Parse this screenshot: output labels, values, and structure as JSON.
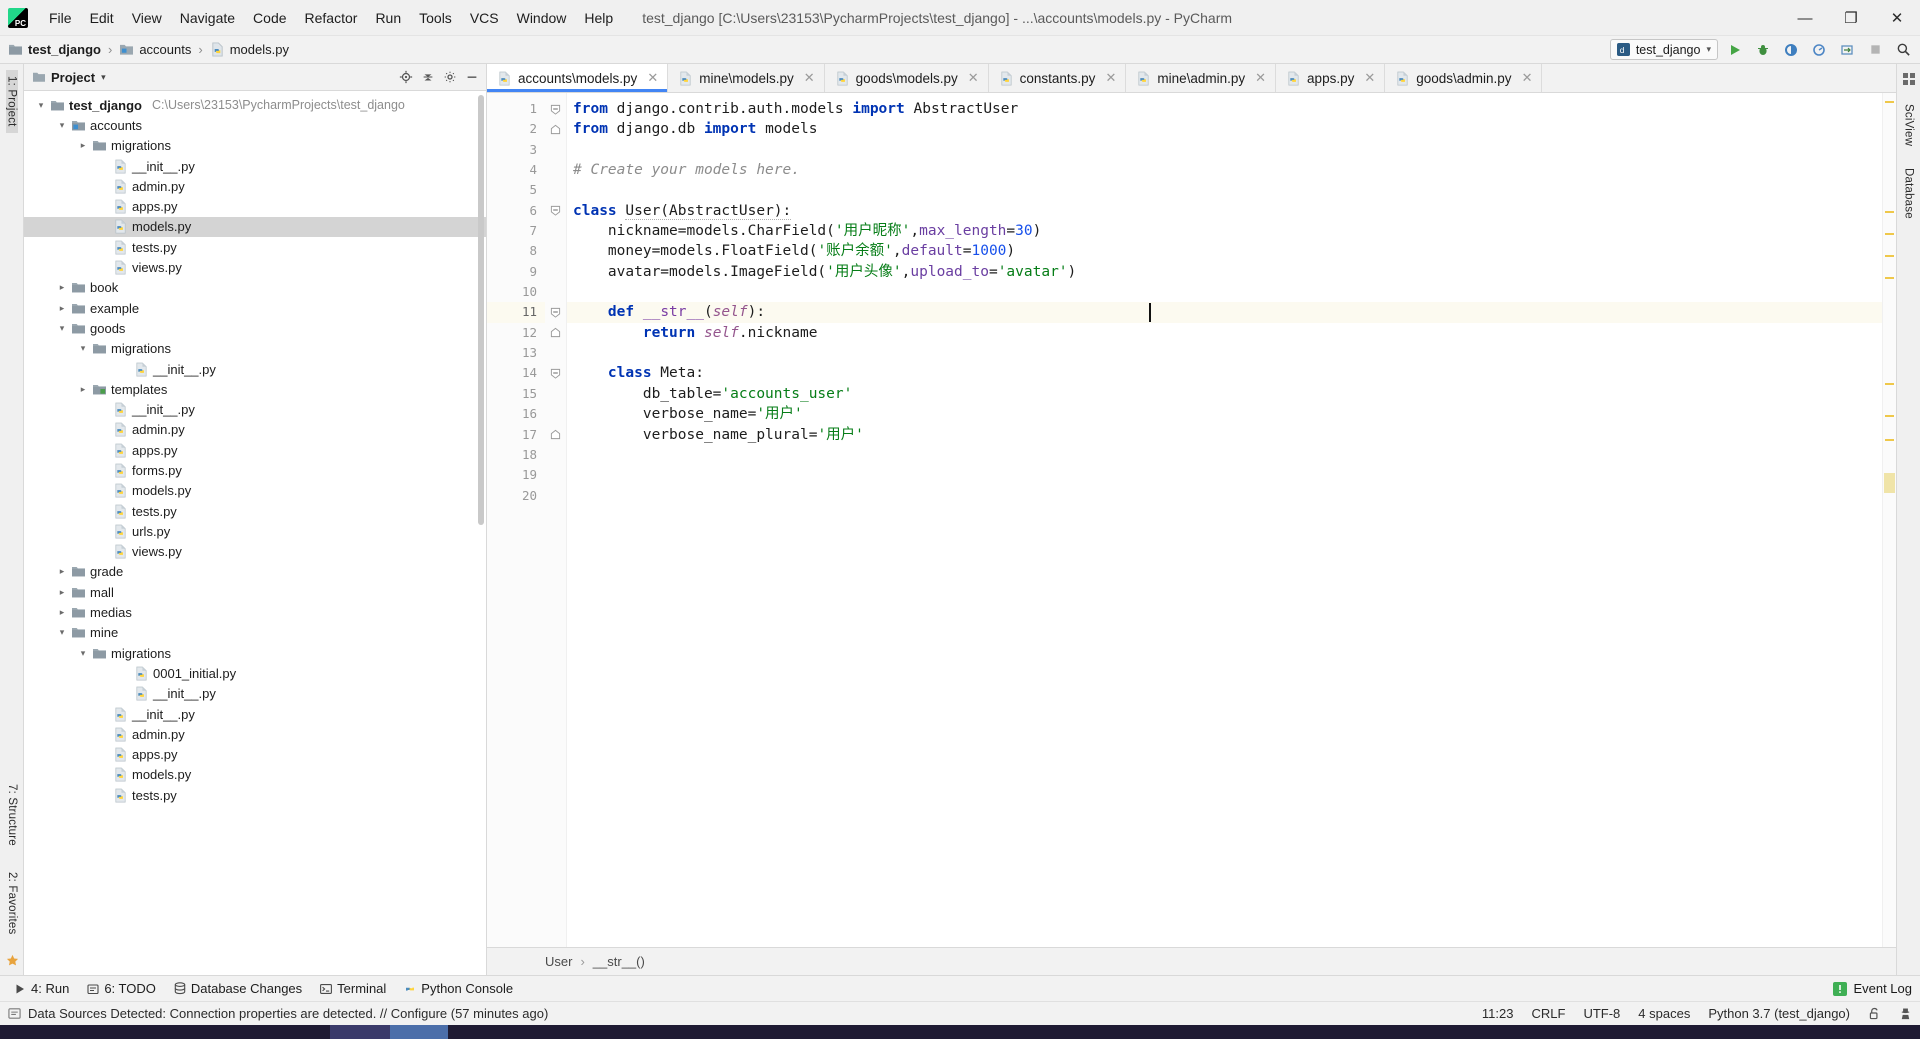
{
  "window": {
    "title": "test_django [C:\\Users\\23153\\PycharmProjects\\test_django] - ...\\accounts\\models.py - PyCharm",
    "minimize_label": "—",
    "maximize_label": "❐",
    "close_label": "✕",
    "logo_text": "PC"
  },
  "menubar": {
    "items": [
      {
        "label": "File"
      },
      {
        "label": "Edit"
      },
      {
        "label": "View"
      },
      {
        "label": "Navigate"
      },
      {
        "label": "Code"
      },
      {
        "label": "Refactor"
      },
      {
        "label": "Run"
      },
      {
        "label": "Tools"
      },
      {
        "label": "VCS"
      },
      {
        "label": "Window"
      },
      {
        "label": "Help"
      }
    ]
  },
  "breadcrumb": {
    "items": [
      {
        "label": "test_django",
        "icon": "folder-icon"
      },
      {
        "label": "accounts",
        "icon": "folder-icon"
      },
      {
        "label": "models.py",
        "icon": "python-file-icon"
      }
    ],
    "separator": "›"
  },
  "navbar_right": {
    "run_config": "test_django",
    "run_config_icon": "django-config-icon",
    "chevron": "▾",
    "buttons": [
      {
        "name": "run-button",
        "icon": "run-icon"
      },
      {
        "name": "debug-button",
        "icon": "debug-icon"
      },
      {
        "name": "run-coverage-button",
        "icon": "coverage-icon"
      },
      {
        "name": "profile-button",
        "icon": "profile-icon"
      },
      {
        "name": "attach-button",
        "icon": "attach-icon"
      },
      {
        "name": "stop-button",
        "icon": "stop-icon"
      },
      {
        "name": "search-everywhere-button",
        "icon": "search-icon"
      }
    ]
  },
  "left_rail": {
    "top_label": "1: Project",
    "bottom_labels": [
      "7: Structure",
      "2: Favorites"
    ]
  },
  "right_rail": {
    "labels": [
      "SciView",
      "Database"
    ]
  },
  "project_panel": {
    "title": "Project",
    "caret": "▾",
    "tools": [
      "locate-icon",
      "collapse-all-icon",
      "settings-icon",
      "hide-icon"
    ],
    "tree": [
      {
        "indent": 0,
        "arrow": "down",
        "icon": "folder-icon",
        "label": "test_django",
        "bold": true,
        "path": "C:\\Users\\23153\\PycharmProjects\\test_django"
      },
      {
        "indent": 1,
        "arrow": "down",
        "icon": "module-icon",
        "label": "accounts"
      },
      {
        "indent": 2,
        "arrow": "right",
        "icon": "folder-blue-icon",
        "label": "migrations"
      },
      {
        "indent": 3,
        "arrow": "none",
        "icon": "python-file-icon",
        "label": "__init__.py"
      },
      {
        "indent": 3,
        "arrow": "none",
        "icon": "python-file-icon",
        "label": "admin.py"
      },
      {
        "indent": 3,
        "arrow": "none",
        "icon": "python-file-icon",
        "label": "apps.py"
      },
      {
        "indent": 3,
        "arrow": "none",
        "icon": "python-file-icon",
        "label": "models.py",
        "selected": true
      },
      {
        "indent": 3,
        "arrow": "none",
        "icon": "python-file-icon",
        "label": "tests.py"
      },
      {
        "indent": 3,
        "arrow": "none",
        "icon": "python-file-icon",
        "label": "views.py"
      },
      {
        "indent": 1,
        "arrow": "right",
        "icon": "folder-blue-icon",
        "label": "book"
      },
      {
        "indent": 1,
        "arrow": "right",
        "icon": "folder-blue-icon",
        "label": "example"
      },
      {
        "indent": 1,
        "arrow": "down",
        "icon": "folder-blue-icon",
        "label": "goods"
      },
      {
        "indent": 2,
        "arrow": "down",
        "icon": "folder-blue-icon",
        "label": "migrations"
      },
      {
        "indent": 4,
        "arrow": "none",
        "icon": "python-file-icon",
        "label": "__init__.py"
      },
      {
        "indent": 2,
        "arrow": "right",
        "icon": "folder-green-icon",
        "label": "templates"
      },
      {
        "indent": 3,
        "arrow": "none",
        "icon": "python-file-icon",
        "label": "__init__.py"
      },
      {
        "indent": 3,
        "arrow": "none",
        "icon": "python-file-icon",
        "label": "admin.py"
      },
      {
        "indent": 3,
        "arrow": "none",
        "icon": "python-file-icon",
        "label": "apps.py"
      },
      {
        "indent": 3,
        "arrow": "none",
        "icon": "python-file-icon",
        "label": "forms.py"
      },
      {
        "indent": 3,
        "arrow": "none",
        "icon": "python-file-icon",
        "label": "models.py"
      },
      {
        "indent": 3,
        "arrow": "none",
        "icon": "python-file-icon",
        "label": "tests.py"
      },
      {
        "indent": 3,
        "arrow": "none",
        "icon": "python-file-icon",
        "label": "urls.py"
      },
      {
        "indent": 3,
        "arrow": "none",
        "icon": "python-file-icon",
        "label": "views.py"
      },
      {
        "indent": 1,
        "arrow": "right",
        "icon": "folder-blue-icon",
        "label": "grade"
      },
      {
        "indent": 1,
        "arrow": "right",
        "icon": "folder-blue-icon",
        "label": "mall"
      },
      {
        "indent": 1,
        "arrow": "right",
        "icon": "folder-blue-icon",
        "label": "medias"
      },
      {
        "indent": 1,
        "arrow": "down",
        "icon": "folder-blue-icon",
        "label": "mine"
      },
      {
        "indent": 2,
        "arrow": "down",
        "icon": "folder-blue-icon",
        "label": "migrations"
      },
      {
        "indent": 4,
        "arrow": "none",
        "icon": "python-file-icon",
        "label": "0001_initial.py"
      },
      {
        "indent": 4,
        "arrow": "none",
        "icon": "python-file-icon",
        "label": "__init__.py"
      },
      {
        "indent": 3,
        "arrow": "none",
        "icon": "python-file-icon",
        "label": "__init__.py"
      },
      {
        "indent": 3,
        "arrow": "none",
        "icon": "python-file-icon",
        "label": "admin.py"
      },
      {
        "indent": 3,
        "arrow": "none",
        "icon": "python-file-icon",
        "label": "apps.py"
      },
      {
        "indent": 3,
        "arrow": "none",
        "icon": "python-file-icon",
        "label": "models.py"
      },
      {
        "indent": 3,
        "arrow": "none",
        "icon": "python-file-icon",
        "label": "tests.py"
      }
    ]
  },
  "editor": {
    "tabs": [
      {
        "label": "accounts\\models.py",
        "icon": "python-file-icon",
        "active": true,
        "close": "✕"
      },
      {
        "label": "mine\\models.py",
        "icon": "python-file-icon",
        "active": false,
        "close": "✕"
      },
      {
        "label": "goods\\models.py",
        "icon": "python-file-icon",
        "active": false,
        "close": "✕"
      },
      {
        "label": "constants.py",
        "icon": "python-file-icon",
        "active": false,
        "close": "✕"
      },
      {
        "label": "mine\\admin.py",
        "icon": "python-file-icon",
        "active": false,
        "close": "✕"
      },
      {
        "label": "apps.py",
        "icon": "python-file-icon",
        "active": false,
        "close": "✕"
      },
      {
        "label": "goods\\admin.py",
        "icon": "python-file-icon",
        "active": false,
        "close": "✕"
      }
    ],
    "line_numbers": [
      "1",
      "2",
      "3",
      "4",
      "5",
      "6",
      "7",
      "8",
      "9",
      "10",
      "11",
      "12",
      "13",
      "14",
      "15",
      "16",
      "17",
      "18",
      "19",
      "20"
    ],
    "current_line": 11,
    "code_lines": [
      {
        "n": 1,
        "html": "<span class=\"kw\">from</span> django.contrib.auth.models <span class=\"kw\">import</span> AbstractUser",
        "fold": "open"
      },
      {
        "n": 2,
        "html": "<span class=\"kw\">from</span> django.db <span class=\"kw\">import</span> models",
        "fold": "end"
      },
      {
        "n": 3,
        "html": ""
      },
      {
        "n": 4,
        "html": "<span class=\"cmt\"># Create your models here.</span>"
      },
      {
        "n": 5,
        "html": ""
      },
      {
        "n": 6,
        "html": "<span class=\"kw\">class</span> <span class=\"cls mark-err\">User(AbstractUser):</span>",
        "fold": "open"
      },
      {
        "n": 7,
        "html": "    nickname=models.CharField(<span class=\"str\">'用户昵称'</span>,<span class=\"param\">max_length</span>=<span class=\"num\">30</span>)"
      },
      {
        "n": 8,
        "html": "    money=models.FloatField(<span class=\"str\">'账户余额'</span>,<span class=\"param\">default</span>=<span class=\"num\">1000</span>)"
      },
      {
        "n": 9,
        "html": "    avatar=models.ImageField(<span class=\"str\">'用户头像'</span>,<span class=\"param\">upload_to</span>=<span class=\"str\">'avatar'</span>)"
      },
      {
        "n": 10,
        "html": ""
      },
      {
        "n": 11,
        "html": "    <span class=\"kw\">def</span> <span class=\"fn\">__str__</span>(<span class=\"self\">self</span>):",
        "fold": "open",
        "gutter_icon": "override-method-icon",
        "current": true
      },
      {
        "n": 12,
        "html": "        <span class=\"kw\">return</span> <span class=\"self\">self</span>.nickname",
        "fold": "end"
      },
      {
        "n": 13,
        "html": ""
      },
      {
        "n": 14,
        "html": "    <span class=\"kw\">class</span> Meta:",
        "fold": "open"
      },
      {
        "n": 15,
        "html": "        db_table=<span class=\"str\">'accounts_user'</span>"
      },
      {
        "n": 16,
        "html": "        verbose_name=<span class=\"str\">'用户'</span>"
      },
      {
        "n": 17,
        "html": "        verbose_name_plural=<span class=\"str\">'用户'</span>",
        "fold": "end"
      },
      {
        "n": 18,
        "html": ""
      },
      {
        "n": 19,
        "html": ""
      },
      {
        "n": 20,
        "html": ""
      }
    ],
    "breadcrumb_bottom": {
      "items": [
        "User",
        "__str__()"
      ],
      "separator": "›"
    }
  },
  "bottom_toolbar": {
    "items": [
      {
        "label": "4: Run",
        "icon": "run-small-icon"
      },
      {
        "label": "6: TODO",
        "icon": "todo-icon"
      },
      {
        "label": "Database Changes",
        "icon": "database-icon"
      },
      {
        "label": "Terminal",
        "icon": "terminal-icon"
      },
      {
        "label": "Python Console",
        "icon": "python-console-icon"
      }
    ],
    "right": {
      "label": "Event Log",
      "icon": "event-log-icon"
    }
  },
  "statusbar": {
    "message": "Data Sources Detected: Connection properties are detected. // Configure (57 minutes ago)",
    "message_icon": "info-icon",
    "right": [
      {
        "name": "caret-position",
        "label": "11:23"
      },
      {
        "name": "line-separator",
        "label": "CRLF"
      },
      {
        "name": "file-encoding",
        "label": "UTF-8"
      },
      {
        "name": "indent",
        "label": "4 spaces"
      },
      {
        "name": "python-interpreter",
        "label": "Python 3.7 (test_django)"
      },
      {
        "name": "lock-icon",
        "label": "🔓"
      },
      {
        "name": "hector-icon",
        "label": "♟"
      }
    ]
  },
  "colors": {
    "accent": "#4285f4",
    "keyword": "#0033b3",
    "string": "#067d17",
    "number": "#1750eb",
    "comment": "#8c8c8c",
    "selection": "#d4d4d4",
    "current_line": "#fcfaf0"
  }
}
